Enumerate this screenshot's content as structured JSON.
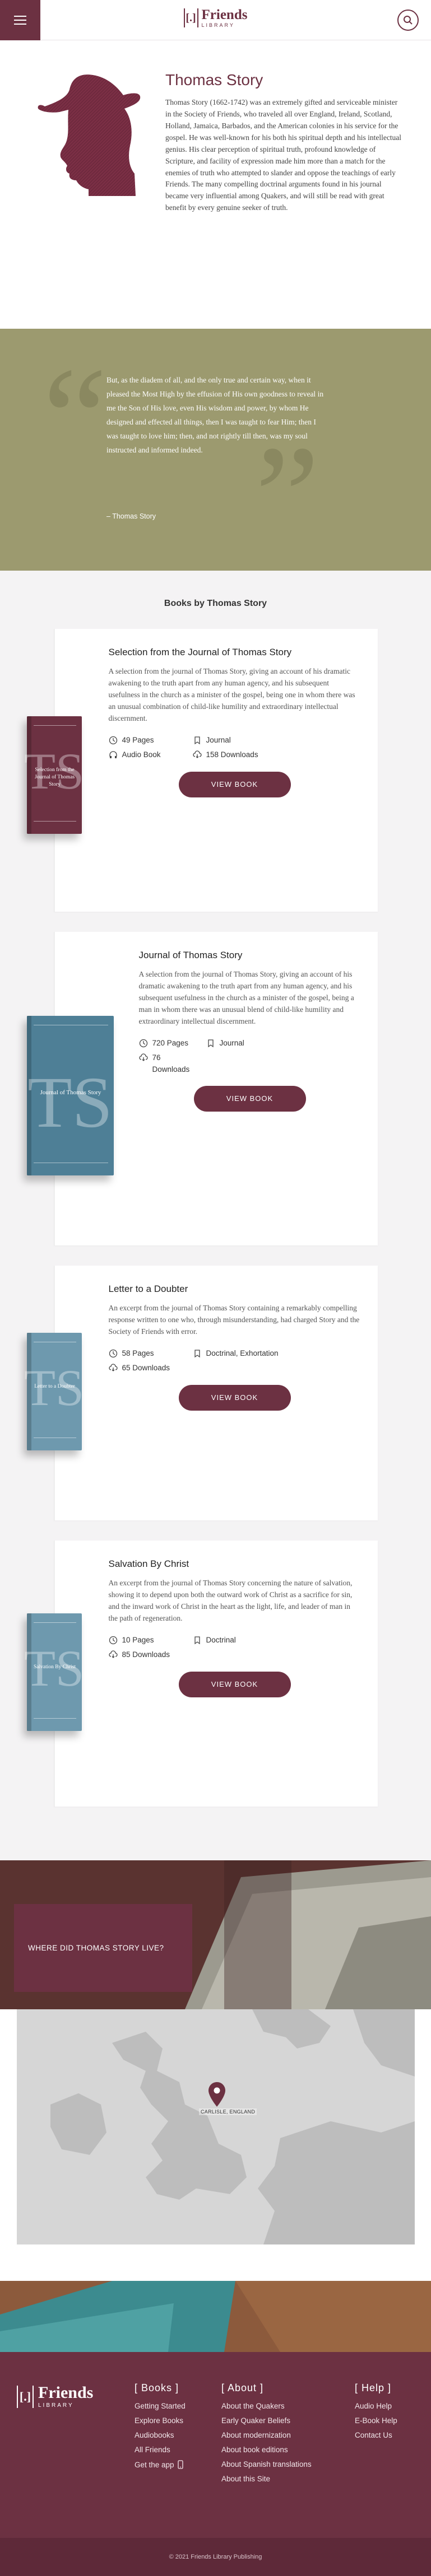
{
  "header": {
    "brand_mark": "[.]",
    "brand_name": "Friends",
    "brand_sub": "LIBRARY",
    "menu_icon": "hamburger-icon",
    "search_icon": "search-icon"
  },
  "author": {
    "name": "Thomas Story",
    "bio": "Thomas Story (1662-1742) was an extremely gifted and serviceable minister in the Society of Friends, who traveled all over England, Ireland, Scotland, Holland, Jamaica, Barbados, and the American colonies in his service for the gospel. He was well-known for his both his spiritual depth and his intellectual genius. His clear perception of spiritual truth, profound knowledge of Scripture, and facility of expression made him more than a match for the enemies of truth who attempted to slander and oppose the teachings of early Friends. The many compelling doctrinal arguments found in his journal became very influential among Quakers, and will still be read with great benefit by every genuine seeker of truth."
  },
  "quote": {
    "text": "But, as the diadem of all, and the only true and certain way, when it pleased the Most High by the effusion of His own goodness to reveal in me the Son of His love, even His wisdom and power, by whom He designed and effected all things, then I was taught to fear Him; then I was taught to love him; then, and not rightly till then, was my soul instructed and informed indeed.",
    "cite": "– Thomas Story"
  },
  "books_heading": "Books by Thomas Story",
  "books": [
    {
      "title": "Selection from the Journal of Thomas Story",
      "description": "A selection from the journal of Thomas Story, giving an account of his dramatic awakening to the truth apart from any human agency, and his subsequent usefulness in the church as a minister of the gospel, being one in whom there was an unusual combination of child-like humility and extraordinary intellectual discernment.",
      "pages": "49 Pages",
      "type": "Journal",
      "extra": "Audio Book",
      "downloads": "158 Downloads",
      "button": "VIEW BOOK",
      "cover_color": "#6c3142",
      "cover_letter": "TS",
      "cover_title": "Selection from the Journal of Thomas Story"
    },
    {
      "title": "Journal of Thomas Story",
      "description": "A selection from the journal of Thomas Story, giving an account of his dramatic awakening to the truth apart from any human agency, and his subsequent usefulness in the church as a minister of the gospel, being a man in whom there was an unusual blend of child-like humility and extraordinary intellectual discernment.",
      "pages": "720 Pages",
      "type": "Journal",
      "downloads_count": "76",
      "downloads_label": "Downloads",
      "button": "VIEW BOOK",
      "cover_color": "#4e7f96",
      "cover_letter": "TS",
      "cover_title": "Journal of Thomas Story"
    },
    {
      "title": "Letter to a Doubter",
      "description": "An excerpt from the journal of Thomas Story containing a remarkably compelling response written to one who, through misunderstanding, had charged Story and the Society of Friends with error.",
      "pages": "58 Pages",
      "type": "Doctrinal, Exhortation",
      "downloads": "65 Downloads",
      "button": "VIEW BOOK",
      "cover_color": "#6e99ae",
      "cover_letter": "TS",
      "cover_title": "Letter to a Doubter"
    },
    {
      "title": "Salvation By Christ",
      "description": "An excerpt from the journal of Thomas Story concerning the nature of salvation, showing it to depend upon both the outward work of Christ as a sacrifice for sin, and the inward work of Christ in the heart as the light, life, and leader of man in the path of regeneration.",
      "pages": "10 Pages",
      "type": "Doctrinal",
      "downloads": "85 Downloads",
      "button": "VIEW BOOK",
      "cover_color": "#6e99ae",
      "cover_letter": "TS",
      "cover_title": "Salvation By Christ"
    }
  ],
  "where": {
    "heading": "WHERE DID THOMAS STORY LIVE?",
    "pin_label": "CARLISLE, ENGLAND",
    "pin_icon": "map-pin-icon"
  },
  "footer": {
    "brand_mark": "[.]",
    "brand_name": "Friends",
    "brand_sub": "LIBRARY",
    "books_heading": "[ Books ]",
    "books_links": [
      "Getting Started",
      "Explore Books",
      "Audiobooks",
      "All Friends"
    ],
    "get_app": "Get the app",
    "about_heading": "[ About ]",
    "about_links": [
      "About the Quakers",
      "Early Quaker Beliefs",
      "About modernization",
      "About book editions",
      "About Spanish translations",
      "About this Site"
    ],
    "help_heading": "[ Help ]",
    "help_links": [
      "Audio Help",
      "E-Book Help",
      "Contact Us"
    ],
    "copyright": "© 2021 Friends Library Publishing"
  }
}
